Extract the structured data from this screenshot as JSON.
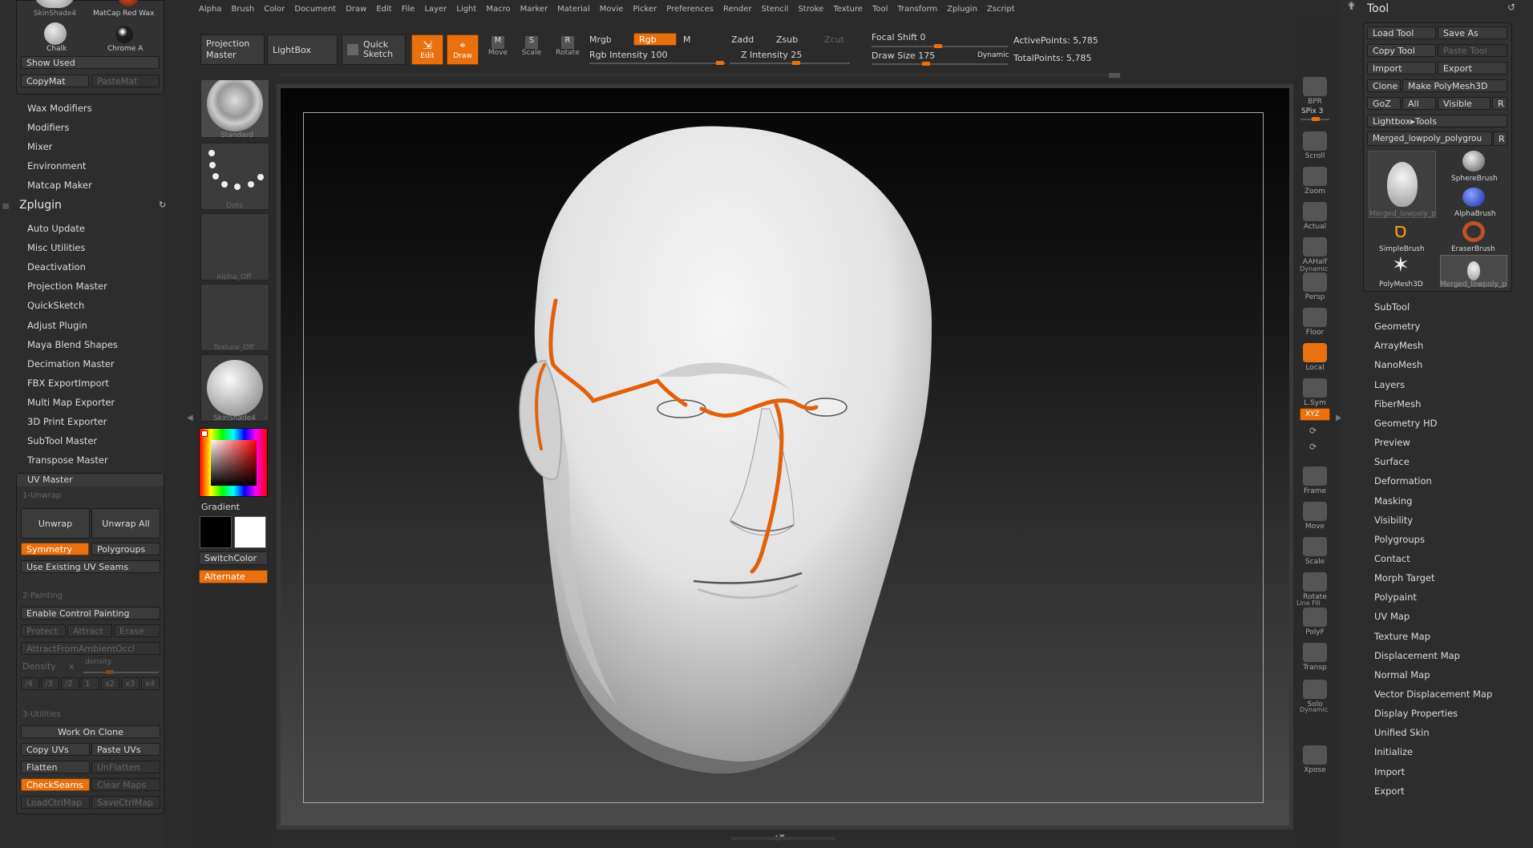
{
  "menu": [
    "Alpha",
    "Brush",
    "Color",
    "Document",
    "Draw",
    "Edit",
    "File",
    "Layer",
    "Light",
    "Macro",
    "Marker",
    "Material",
    "Movie",
    "Picker",
    "Preferences",
    "Render",
    "Stencil",
    "Stroke",
    "Texture",
    "Tool",
    "Transform",
    "Zplugin",
    "Zscript"
  ],
  "leftTop": {
    "mat1": "SkinShade4",
    "mat2": "MatCap Red Wax",
    "mat3": "Chalk",
    "mat4": "Chrome A",
    "show_used": "Show Used",
    "copymat": "CopyMat",
    "pastemat": "PasteMat"
  },
  "leftMenu": [
    "Wax Modifiers",
    "Modifiers",
    "Mixer",
    "Environment",
    "Matcap Maker"
  ],
  "zplugin": {
    "title": "Zplugin",
    "items": [
      "Auto Update",
      "Misc Utilities",
      "Deactivation",
      "Projection Master",
      "QuickSketch",
      "Adjust Plugin",
      "Maya Blend Shapes",
      "Decimation Master",
      "FBX ExportImport",
      "Multi Map Exporter",
      "3D Print Exporter",
      "SubTool Master",
      "Transpose Master"
    ]
  },
  "uvmaster": {
    "title": "UV Master",
    "s1": "1-Unwrap",
    "unwrap": "Unwrap",
    "unwrap_all": "Unwrap All",
    "symmetry": "Symmetry",
    "polygroups": "Polygroups",
    "use_seams": "Use Existing UV Seams",
    "s2": "2-Painting",
    "enable_cp": "Enable Control Painting",
    "protect": "Protect",
    "attract": "Attract",
    "erase": "Erase",
    "attract_ao": "AttractFromAmbientOccl",
    "density": "Density",
    "density_x": "x",
    "density_label": "density.",
    "d_opts": [
      "/4",
      "/3",
      "/2",
      "1",
      "x2",
      "x3",
      "x4"
    ],
    "s3": "3-Utilities",
    "work_on_clone": "Work On Clone",
    "copy_uvs": "Copy UVs",
    "paste_uvs": "Paste UVs",
    "flatten": "Flatten",
    "unflatten": "UnFlatten",
    "checkseams": "CheckSeams",
    "clear_maps": "Clear Maps",
    "loadctrl": "LoadCtrlMap",
    "savectrl": "SaveCtrlMap"
  },
  "shelf": {
    "standard": "Standard",
    "dots": "Dots",
    "alpha_off": "Alpha_Off",
    "texture_off": "Texture_Off",
    "skinshade": "SkinShade4",
    "gradient": "Gradient",
    "switchcolor": "SwitchColor",
    "alternate": "Alternate"
  },
  "toolbar": {
    "projection_master": "Projection Master",
    "lightbox": "LightBox",
    "quick_sketch": "Quick Sketch",
    "edit": "Edit",
    "draw": "Draw",
    "move": "Move",
    "scale": "Scale",
    "rotate": "Rotate",
    "mrgb": "Mrgb",
    "rgb": "Rgb",
    "m": "M",
    "rgb_intensity": "Rgb Intensity 100",
    "zadd": "Zadd",
    "zsub": "Zsub",
    "zcut": "Zcut",
    "z_intensity": "Z Intensity 25",
    "focal_shift": "Focal Shift 0",
    "draw_size": "Draw Size 175",
    "dynamic": "Dynamic",
    "active_points": "ActivePoints: 5,785",
    "total_points": "TotalPoints: 5,785"
  },
  "rightShelf": [
    {
      "label": "BPR",
      "on": false
    },
    {
      "label": "Scroll",
      "on": false
    },
    {
      "label": "Zoom",
      "on": false
    },
    {
      "label": "Actual",
      "on": false
    },
    {
      "label": "AAHalf",
      "on": false
    },
    {
      "label": "Persp",
      "on": false
    },
    {
      "label": "Floor",
      "on": false
    },
    {
      "label": "Local",
      "on": true
    },
    {
      "label": "L.Sym",
      "on": false
    },
    {
      "label": "Frame",
      "on": false
    },
    {
      "label": "Move",
      "on": false
    },
    {
      "label": "Scale",
      "on": false
    },
    {
      "label": "Rotate",
      "on": false
    },
    {
      "label": "PolyF",
      "on": false
    },
    {
      "label": "Transp",
      "on": false
    },
    {
      "label": "Solo",
      "on": false
    },
    {
      "label": "Xpose",
      "on": false
    }
  ],
  "rightShelfExtra": {
    "spix": "SPix 3",
    "dynamic1": "Dynamic",
    "xyz": "XYZ",
    "linefill": "Line Fill",
    "dynamic2": "Dynamic"
  },
  "toolPanel": {
    "title": "Tool",
    "load_tool": "Load Tool",
    "save_as": "Save As",
    "copy_tool": "Copy Tool",
    "paste_tool": "Paste Tool",
    "import": "Import",
    "export": "Export",
    "clone": "Clone",
    "make_polymesh": "Make PolyMesh3D",
    "goz": "GoZ",
    "all": "All",
    "visible": "Visible",
    "r": "R",
    "lightbox_tools": "Lightbox▸Tools",
    "current_tool": "Merged_lowpoly_polygrou",
    "thumbs": [
      "Merged_lowpoly_p",
      "SphereBrush",
      "AlphaBrush",
      "SimpleBrush",
      "EraserBrush",
      "PolyMesh3D",
      "Merged_lowpoly_p"
    ]
  },
  "toolMenu": [
    "SubTool",
    "Geometry",
    "ArrayMesh",
    "NanoMesh",
    "Layers",
    "FiberMesh",
    "Geometry HD",
    "Preview",
    "Surface",
    "Deformation",
    "Masking",
    "Visibility",
    "Polygroups",
    "Contact",
    "Morph Target",
    "Polypaint",
    "UV Map",
    "Texture Map",
    "Displacement Map",
    "Normal Map",
    "Vector Displacement Map",
    "Display Properties",
    "Unified Skin",
    "Initialize",
    "Import",
    "Export"
  ],
  "colors": {
    "accent": "#e8700f",
    "bg": "#2b2b2b",
    "seam": "#e2600a"
  }
}
